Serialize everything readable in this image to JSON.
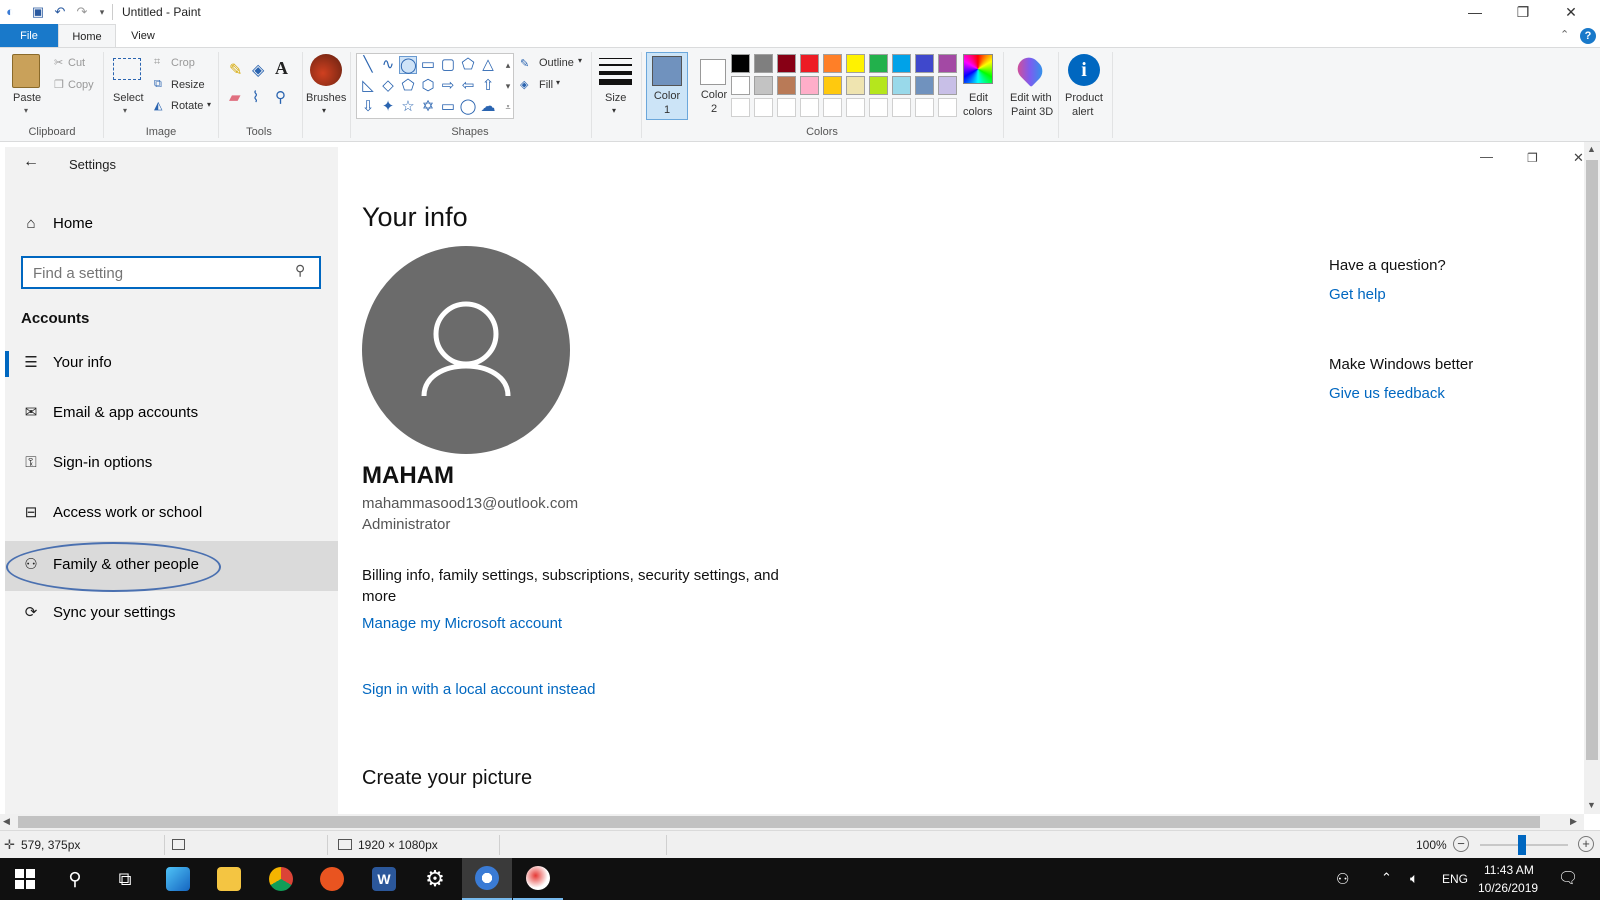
{
  "paint": {
    "title": "Untitled - Paint",
    "tabs": {
      "file": "File",
      "home": "Home",
      "view": "View"
    },
    "clipboard": {
      "paste": "Paste",
      "cut": "Cut",
      "copy": "Copy",
      "label": "Clipboard"
    },
    "image": {
      "select": "Select",
      "crop": "Crop",
      "resize": "Resize",
      "rotate": "Rotate",
      "label": "Image"
    },
    "tools": {
      "label": "Tools"
    },
    "brushes": "Brushes",
    "shapes": {
      "outline": "Outline",
      "fill": "Fill",
      "label": "Shapes"
    },
    "size": "Size",
    "color1": {
      "line1": "Color",
      "line2": "1"
    },
    "color2": {
      "line1": "Color",
      "line2": "2"
    },
    "colors_label": "Colors",
    "edit_colors": {
      "line1": "Edit",
      "line2": "colors"
    },
    "paint3d": {
      "line1": "Edit with",
      "line2": "Paint 3D"
    },
    "product_alert": {
      "line1": "Product",
      "line2": "alert"
    },
    "palette_colors": [
      "#000000",
      "#7f7f7f",
      "#880015",
      "#ed1c24",
      "#ff7f27",
      "#fff200",
      "#22b14c",
      "#00a2e8",
      "#3f48cc",
      "#a349a4",
      "#ffffff",
      "#c3c3c3",
      "#b97a57",
      "#ffaec9",
      "#ffc90e",
      "#efe4b0",
      "#b5e61d",
      "#99d9ea",
      "#7092be",
      "#c8bfe7"
    ],
    "status": {
      "cursor": "579, 375px",
      "dimensions": "1920 × 1080px",
      "zoom": "100%"
    }
  },
  "settings": {
    "title": "Settings",
    "home": "Home",
    "search_placeholder": "Find a setting",
    "section": "Accounts",
    "nav": [
      {
        "label": "Your info",
        "icon": "person-list-icon"
      },
      {
        "label": "Email & app accounts",
        "icon": "mail-icon"
      },
      {
        "label": "Sign-in options",
        "icon": "key-icon"
      },
      {
        "label": "Access work or school",
        "icon": "briefcase-icon"
      },
      {
        "label": "Family & other people",
        "icon": "person-add-icon"
      },
      {
        "label": "Sync your settings",
        "icon": "sync-icon"
      }
    ],
    "page_title": "Your info",
    "user_name": "MAHAM",
    "user_email": "mahammasood13@outlook.com",
    "user_role": "Administrator",
    "billing_text": "Billing info, family settings, subscriptions, security settings, and more",
    "manage_link": "Manage my Microsoft account",
    "local_link": "Sign in with a local account instead",
    "create_picture": "Create your picture",
    "question": "Have a question?",
    "get_help": "Get help",
    "make_better": "Make Windows better",
    "feedback": "Give us feedback"
  },
  "taskbar": {
    "lang": "ENG",
    "time": "11:43 AM",
    "date": "10/26/2019"
  }
}
